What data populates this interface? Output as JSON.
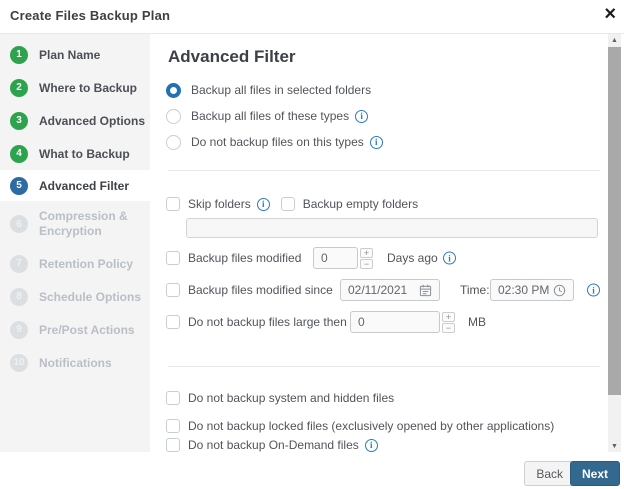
{
  "window": {
    "title": "Create Files Backup Plan"
  },
  "icons": {
    "close": "×",
    "info_glyph": "i",
    "plus": "+",
    "minus": "−",
    "scroll_up": "▲",
    "scroll_down": "▼",
    "calendar": "calendar-icon",
    "clock": "clock-icon"
  },
  "colors": {
    "step_done_green": "#2da34e",
    "step_active_blue": "#2d6ba3",
    "radio_selected_blue": "#2271b3",
    "info_blue": "#2b7bbb",
    "next_button_blue": "#33688f",
    "sidebar_bg": "#f4f4f4"
  },
  "sidebar": {
    "steps": [
      {
        "num": "1",
        "label": "Plan Name",
        "state": "done"
      },
      {
        "num": "2",
        "label": "Where to Backup",
        "state": "done"
      },
      {
        "num": "3",
        "label": "Advanced Options",
        "state": "done"
      },
      {
        "num": "4",
        "label": "What to Backup",
        "state": "done"
      },
      {
        "num": "5",
        "label": "Advanced Filter",
        "state": "active"
      },
      {
        "num": "6",
        "label": "Compression & Encryption",
        "state": "disabled"
      },
      {
        "num": "7",
        "label": "Retention Policy",
        "state": "disabled"
      },
      {
        "num": "8",
        "label": "Schedule Options",
        "state": "disabled"
      },
      {
        "num": "9",
        "label": "Pre/Post Actions",
        "state": "disabled"
      },
      {
        "num": "10",
        "label": "Notifications",
        "state": "disabled"
      }
    ]
  },
  "main": {
    "heading": "Advanced Filter",
    "radios": [
      {
        "label": "Backup all files in selected folders",
        "selected": true,
        "info": false
      },
      {
        "label": "Backup all files of these types",
        "selected": false,
        "info": true
      },
      {
        "label": "Do not backup files on this types",
        "selected": false,
        "info": true
      }
    ],
    "skip_folders_label": "Skip folders",
    "backup_empty_label": "Backup empty folders",
    "folders_value": "",
    "modified_row": {
      "label": "Backup files modified",
      "value": "0",
      "suffix": "Days ago"
    },
    "modified_since_row": {
      "label": "Backup files modified since",
      "date": "02/11/2021",
      "time_label": "Time:",
      "time": "02:30 PM"
    },
    "large_row": {
      "label": "Do not backup files large then",
      "value": "0",
      "suffix": "MB"
    },
    "bottom_checks": [
      {
        "label": "Do not backup system and hidden files",
        "info": false
      },
      {
        "label": "Do not backup locked files (exclusively opened by other applications)",
        "info": false
      },
      {
        "label": "Do not backup On-Demand files",
        "info": true
      }
    ]
  },
  "footer": {
    "back_label": "Back",
    "next_label": "Next"
  }
}
